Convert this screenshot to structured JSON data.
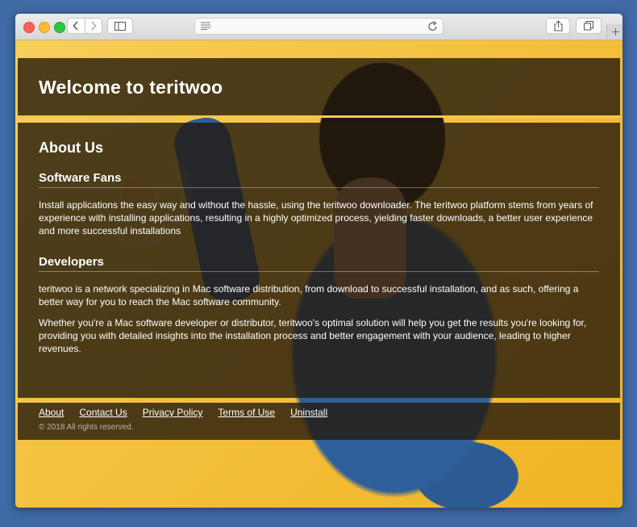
{
  "browser": {
    "icons": {
      "back": "chevron-left-icon",
      "forward": "chevron-right-icon",
      "sidebar": "sidebar-icon",
      "reader": "reader-icon",
      "reload": "reload-icon",
      "share": "share-icon",
      "tabs": "tabs-icon",
      "newtab": "plus-icon"
    }
  },
  "page": {
    "header": {
      "title": "Welcome to teritwoo"
    },
    "about": {
      "heading": "About Us",
      "fans_heading": "Software Fans",
      "fans_text": "Install applications the easy way and without the hassle, using the teritwoo downloader. The teritwoo platform stems from years of experience with installing applications, resulting in a highly optimized process, yielding faster downloads, a better user experience and more successful installations",
      "dev_heading": "Developers",
      "dev_text_1": "teritwoo is a network specializing in Mac software distribution, from download to successful installation, and as such, offering a better way for you to reach the Mac software community.",
      "dev_text_2": "Whether you're a Mac software developer or distributor, teritwoo's optimal solution will help you get the results you're looking for, providing you with detailed insights into the installation process and better engagement with your audience, leading to higher revenues."
    },
    "footer": {
      "links": [
        "About",
        "Contact Us",
        "Privacy Policy",
        "Terms of Use",
        "Uninstall"
      ],
      "copyright": "© 2018 All rights reserved."
    }
  },
  "colors": {
    "background": "#f4c64a",
    "panel": "#23190c",
    "accent_line": "#f5c84d",
    "desktop": "#3f6aa5"
  }
}
